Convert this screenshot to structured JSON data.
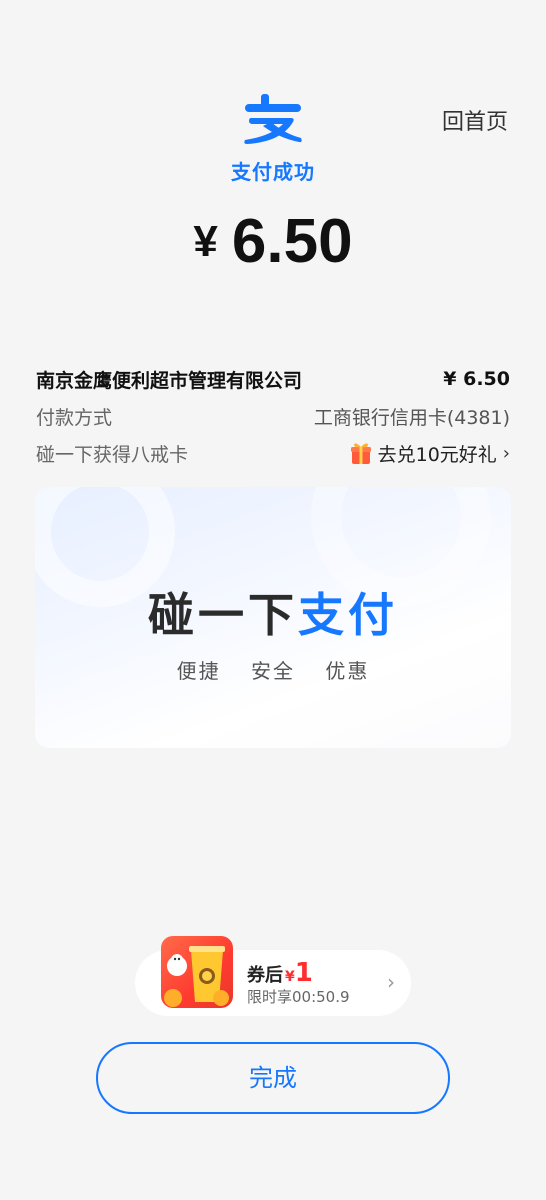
{
  "header": {
    "home_label": "回首页",
    "brand_color": "#1677ff",
    "status_text": "支付成功"
  },
  "payment": {
    "currency_symbol": "¥",
    "amount": "6.50"
  },
  "details": {
    "merchant_name": "南京金鹰便利超市管理有限公司",
    "merchant_amount": "¥ 6.50",
    "method_label": "付款方式",
    "method_value": "工商银行信用卡(4381)",
    "promo_label": "碰一下获得八戒卡",
    "promo_link": "去兑10元好礼",
    "promo_chevron": "›"
  },
  "banner": {
    "title_dark": "碰一下",
    "title_blue": "支付",
    "subtitle": "便捷 安全 优惠"
  },
  "coupon": {
    "label": "券后",
    "price_symbol": "¥",
    "price_value": "1",
    "time_text": "限时享00:50.9",
    "chevron": "›"
  },
  "done_button": "完成",
  "icons": {
    "logo": "alipay-logo-icon",
    "gift": "gift-box-icon",
    "coupon_image": "drink-cup-icon"
  }
}
